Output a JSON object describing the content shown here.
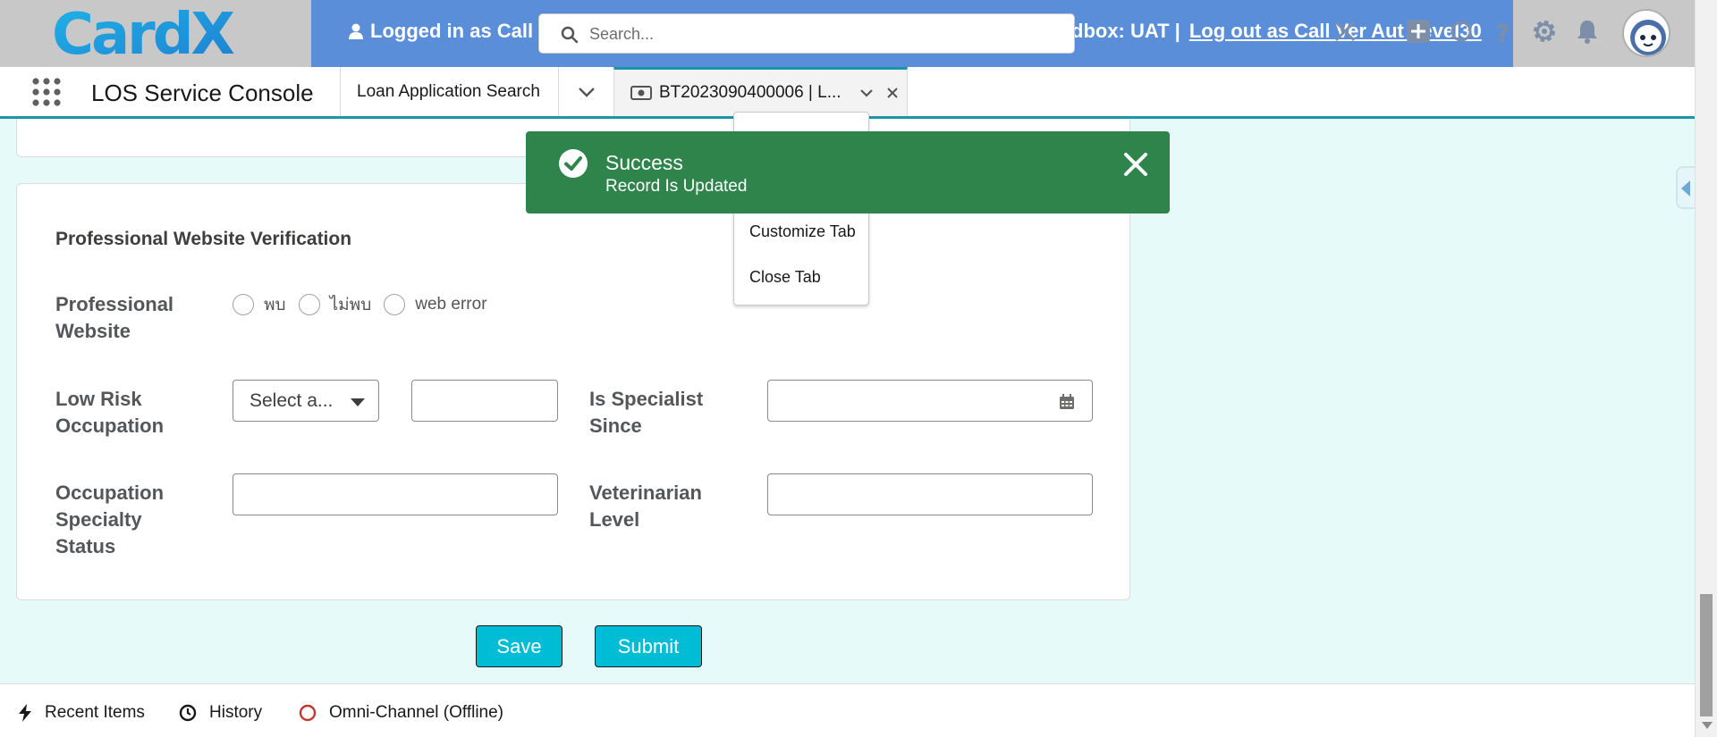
{
  "header": {
    "logo_text": "CardX",
    "logged_in_text": "Logged in as Call",
    "sandbox_text": "dbox: UAT |",
    "logout_link": "Log out as Call Ver Aut Level30",
    "search_placeholder": "Search..."
  },
  "nav": {
    "app_name": "LOS Service Console",
    "tabs": [
      {
        "label": "Loan Application Search"
      },
      {
        "label": "BT2023090400006 | L..."
      }
    ]
  },
  "tab_menu": {
    "items": [
      "Customize Tab",
      "Close Tab"
    ]
  },
  "toast": {
    "title": "Success",
    "message": "Record Is Updated",
    "color": "#2e844a"
  },
  "form": {
    "section_title": "Professional Website Verification",
    "professional_website_label": "Professional Website",
    "radio_options": [
      "พบ",
      "ไม่พบ",
      "web error"
    ],
    "low_risk_occupation_label": "Low Risk Occupation",
    "low_risk_select_value": "Select a...",
    "is_specialist_since_label": "Is Specialist Since",
    "occupation_specialty_status_label": "Occupation Specialty Status",
    "veterinarian_level_label": "Veterinarian Level"
  },
  "buttons": {
    "save": "Save",
    "submit": "Submit"
  },
  "utility_bar": {
    "items": [
      "Recent Items",
      "History",
      "Omni-Channel (Offline)"
    ]
  },
  "colors": {
    "accent": "#1b96a8",
    "button_bg": "#00bcd4",
    "banner_bg": "#5b8ed8",
    "page_bg": "#e6fafa"
  }
}
